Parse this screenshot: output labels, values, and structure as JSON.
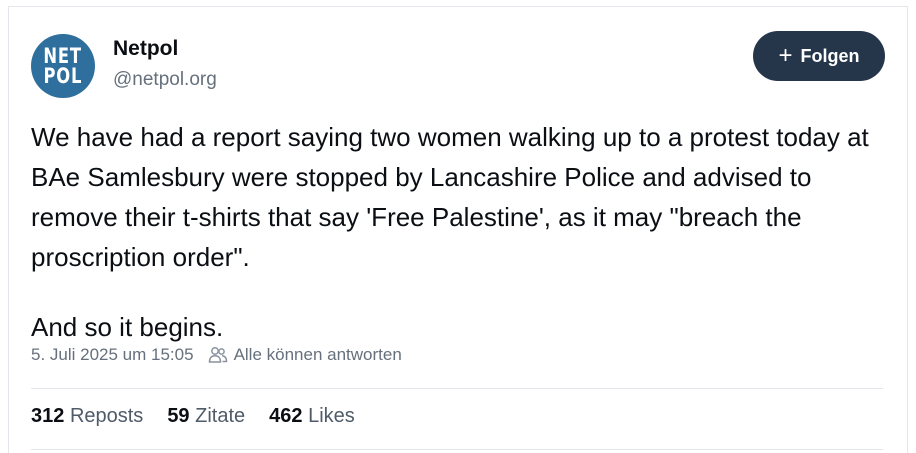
{
  "author": {
    "avatar_line1": "NET",
    "avatar_line2": "POL",
    "display_name": "Netpol",
    "handle": "@netpol.org",
    "avatar_color": "#2f6f9d"
  },
  "follow_button": {
    "label": "Folgen",
    "icon": "plus-icon",
    "color": "#25364a"
  },
  "post": {
    "paragraph1": "We have had a report saying two women walking up to a protest today at BAe Samlesbury were stopped by Lancashire Police and advised to remove their t-shirts that say 'Free Palestine', as it may \"breach the proscription order\".",
    "paragraph2": "And so it begins."
  },
  "meta": {
    "timestamp": "5. Juli 2025 um 15:05",
    "reply_setting_icon": "people-icon",
    "reply_setting": "Alle können antworten"
  },
  "stats": {
    "reposts_count": "312",
    "reposts_label": "Reposts",
    "quotes_count": "59",
    "quotes_label": "Zitate",
    "likes_count": "462",
    "likes_label": "Likes"
  }
}
